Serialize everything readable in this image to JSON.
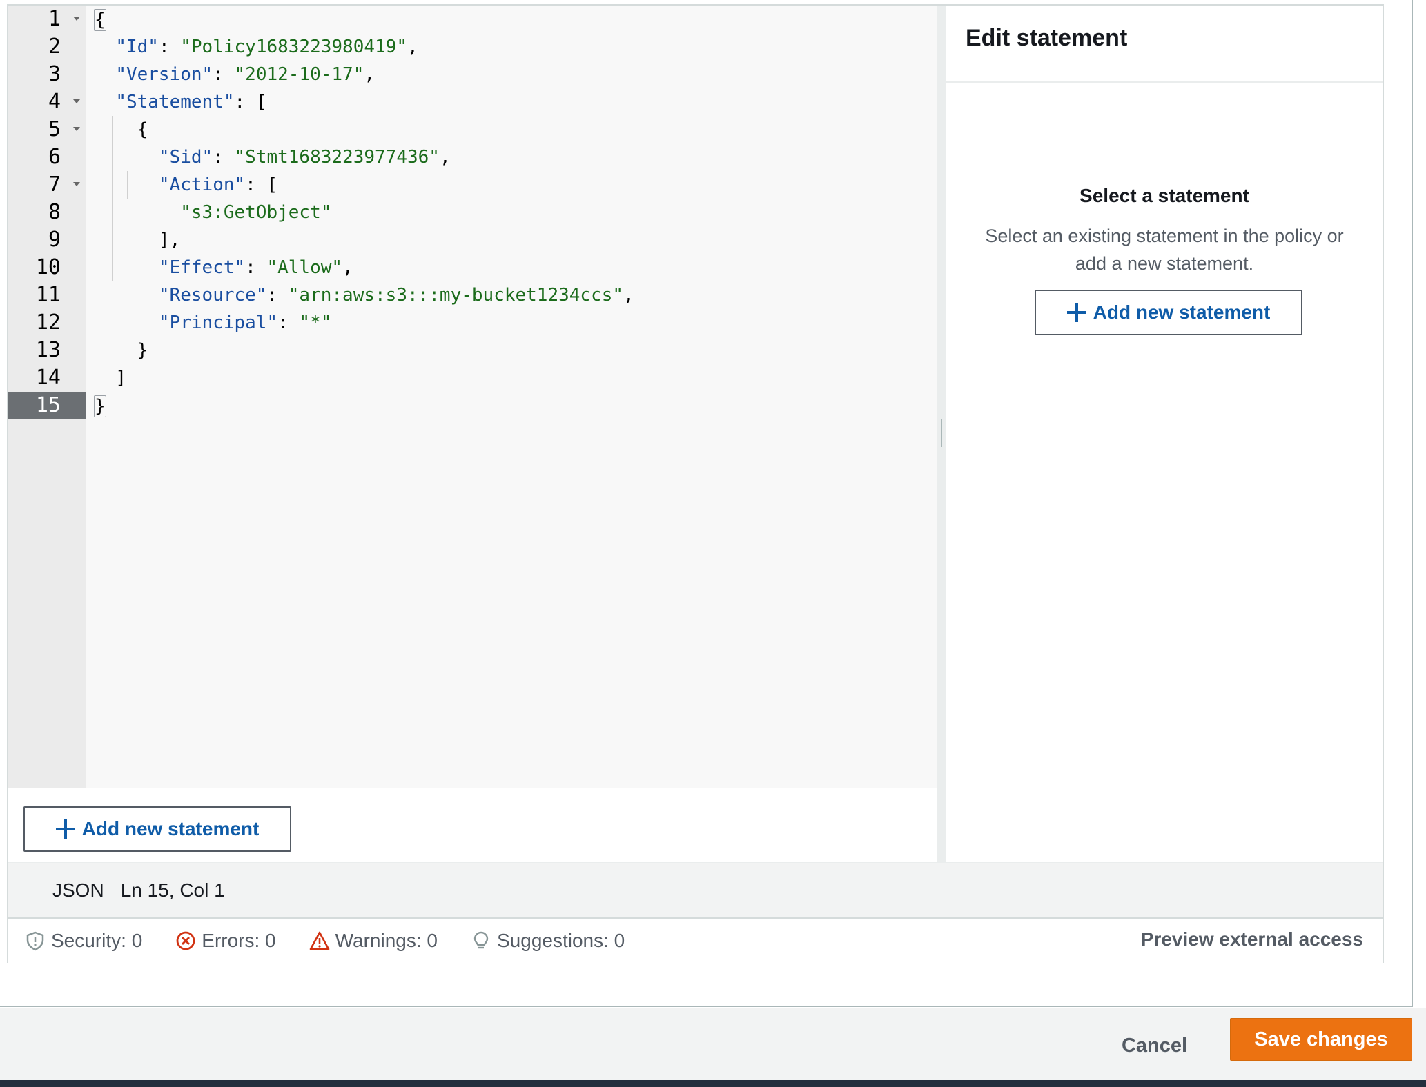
{
  "editor": {
    "lines": [
      {
        "n": "1",
        "fold": true
      },
      {
        "n": "2",
        "fold": false
      },
      {
        "n": "3",
        "fold": false
      },
      {
        "n": "4",
        "fold": true
      },
      {
        "n": "5",
        "fold": true
      },
      {
        "n": "6",
        "fold": false
      },
      {
        "n": "7",
        "fold": true
      },
      {
        "n": "8",
        "fold": false
      },
      {
        "n": "9",
        "fold": false
      },
      {
        "n": "10",
        "fold": false
      },
      {
        "n": "11",
        "fold": false
      },
      {
        "n": "12",
        "fold": false
      },
      {
        "n": "13",
        "fold": false
      },
      {
        "n": "14",
        "fold": false
      },
      {
        "n": "15",
        "fold": false,
        "active": true
      }
    ],
    "code": {
      "open_brace": "{",
      "id_key": "\"Id\"",
      "id_value": "\"Policy1683223980419\"",
      "version_key": "\"Version\"",
      "version_value": "\"2012-10-17\"",
      "statement_key": "\"Statement\"",
      "open_bracket": "[",
      "obj_open": "{",
      "sid_key": "\"Sid\"",
      "sid_value": "\"Stmt1683223977436\"",
      "action_key": "\"Action\"",
      "action_open": "[",
      "action_value": "\"s3:GetObject\"",
      "action_close": "],",
      "effect_key": "\"Effect\"",
      "effect_value": "\"Allow\"",
      "resource_key": "\"Resource\"",
      "resource_value": "\"arn:aws:s3:::my-bucket1234ccs\"",
      "principal_key": "\"Principal\"",
      "principal_value": "\"*\"",
      "obj_close": "}",
      "close_bracket": "]",
      "close_brace": "}"
    },
    "add_statement_label": "Add new statement"
  },
  "side_panel": {
    "title": "Edit statement",
    "empty_title": "Select a statement",
    "empty_desc_line1": "Select an existing statement in the policy or",
    "empty_desc_line2": "add a new statement.",
    "add_statement_label": "Add new statement"
  },
  "status": {
    "language": "JSON",
    "position": "Ln 15, Col 1"
  },
  "validation": {
    "security": "Security: 0",
    "errors": "Errors: 0",
    "warnings": "Warnings: 0",
    "suggestions": "Suggestions: 0",
    "preview": "Preview external access"
  },
  "footer": {
    "cancel": "Cancel",
    "save": "Save changes"
  },
  "colors": {
    "accent_orange": "#ec7211",
    "link_blue": "#0f5ca8",
    "json_key": "#1a4ea0",
    "json_string": "#1b6b1b",
    "error_red": "#d13212"
  }
}
